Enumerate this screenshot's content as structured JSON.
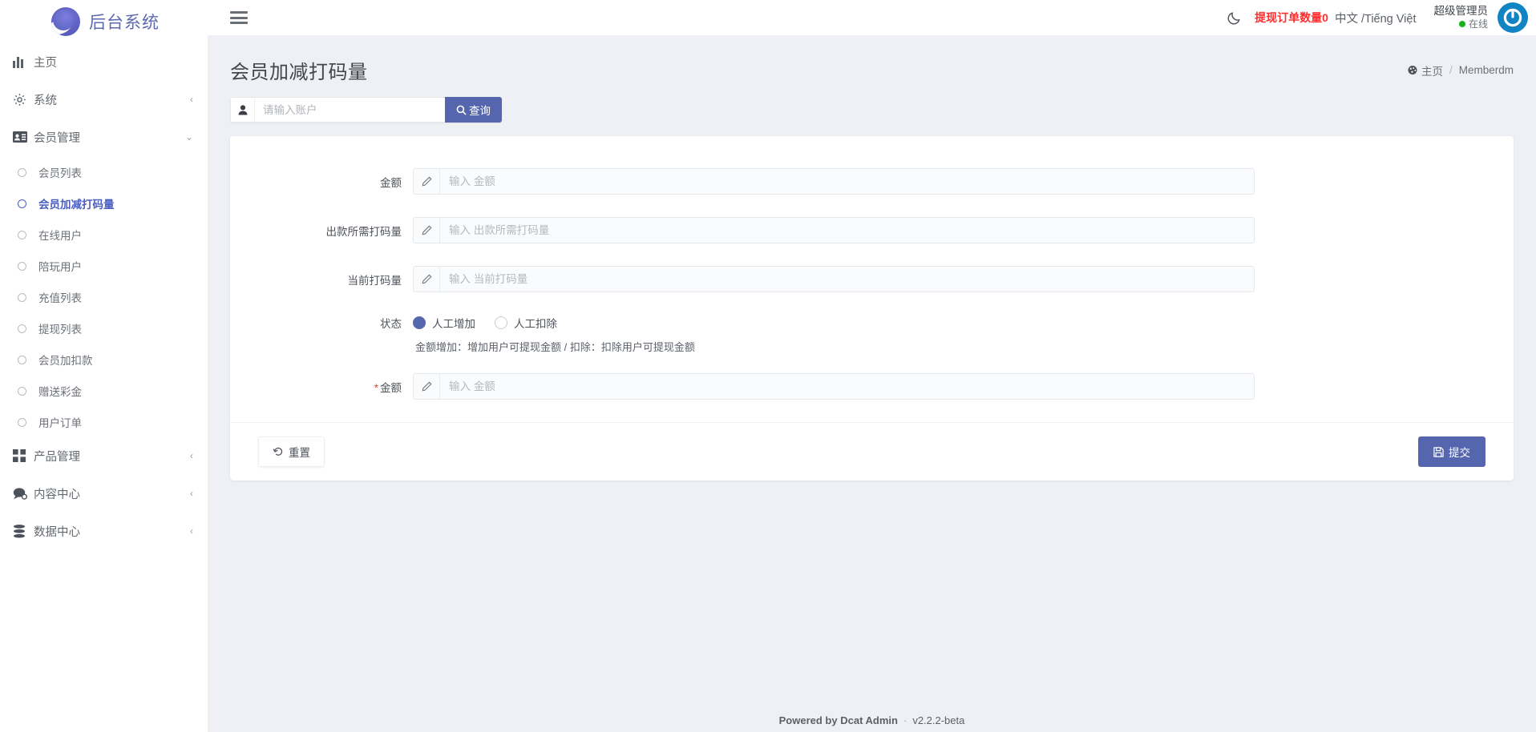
{
  "brand": {
    "name": "后台系统",
    "logo_icon": "swoosh-circle-logo"
  },
  "sidebar": {
    "items": [
      {
        "label": "主页",
        "icon": "bar-chart-icon",
        "arrow": "",
        "type": "top"
      },
      {
        "label": "系统",
        "icon": "gear-icon",
        "arrow": "‹",
        "type": "top"
      },
      {
        "label": "会员管理",
        "icon": "id-card-icon",
        "arrow": "⌄",
        "type": "top"
      }
    ],
    "sub_items": [
      {
        "label": "会员列表",
        "active": false
      },
      {
        "label": "会员加减打码量",
        "active": true
      },
      {
        "label": "在线用户",
        "active": false
      },
      {
        "label": "陪玩用户",
        "active": false
      },
      {
        "label": "充值列表",
        "active": false
      },
      {
        "label": "提现列表",
        "active": false
      },
      {
        "label": "会员加扣款",
        "active": false
      },
      {
        "label": "赠送彩金",
        "active": false
      },
      {
        "label": "用户订单",
        "active": false
      }
    ],
    "bottom_items": [
      {
        "label": "产品管理",
        "icon": "grid-icon",
        "arrow": "‹"
      },
      {
        "label": "内容中心",
        "icon": "chat-icon",
        "arrow": "‹"
      },
      {
        "label": "数据中心",
        "icon": "database-icon",
        "arrow": "‹"
      }
    ]
  },
  "topbar": {
    "menu_icon": "hamburger-icon",
    "theme_icon": "moon-icon",
    "withdraw_alert": "提现订单数量0",
    "language": "中文 /Tiếng Việt",
    "user_name": "超级管理员",
    "user_status": "在线",
    "avatar_icon": "power-button-avatar"
  },
  "page": {
    "title": "会员加减打码量",
    "breadcrumb_home": "主页",
    "breadcrumb_home_icon": "home-icon",
    "breadcrumb_separator": "/",
    "breadcrumb_current": "Memberdm"
  },
  "search": {
    "prefix_icon": "user-icon",
    "placeholder": "请输入账户",
    "value": "",
    "button_label": "查询",
    "button_icon": "search-icon"
  },
  "form": {
    "fields": [
      {
        "label": "金额",
        "placeholder": "输入 金额",
        "value": "",
        "required": false,
        "icon": "pencil-icon"
      },
      {
        "label": "出款所需打码量",
        "placeholder": "输入 出款所需打码量",
        "value": "",
        "required": false,
        "icon": "pencil-icon"
      },
      {
        "label": "当前打码量",
        "placeholder": "输入 当前打码量",
        "value": "",
        "required": false,
        "icon": "pencil-icon"
      }
    ],
    "status": {
      "label": "状态",
      "options": [
        {
          "label": "人工增加",
          "checked": true
        },
        {
          "label": "人工扣除",
          "checked": false
        }
      ],
      "hint": "金额增加：增加用户可提现金额 / 扣除：扣除用户可提现金额"
    },
    "amount_field": {
      "label": "金额",
      "placeholder": "输入 金额",
      "value": "",
      "required": true,
      "icon": "pencil-icon"
    },
    "reset_label": "重置",
    "reset_icon": "undo-icon",
    "submit_label": "提交",
    "submit_icon": "save-icon"
  },
  "footer": {
    "powered_by": "Powered by Dcat Admin",
    "separator": "·",
    "version": "v2.2.2-beta"
  },
  "colors": {
    "accent": "#5566ae",
    "active_link": "#4a5ec2",
    "alert_red": "#ff2d2d",
    "online_green": "#18b318",
    "avatar_blue": "#1284c4",
    "page_bg": "#eef0f5"
  }
}
